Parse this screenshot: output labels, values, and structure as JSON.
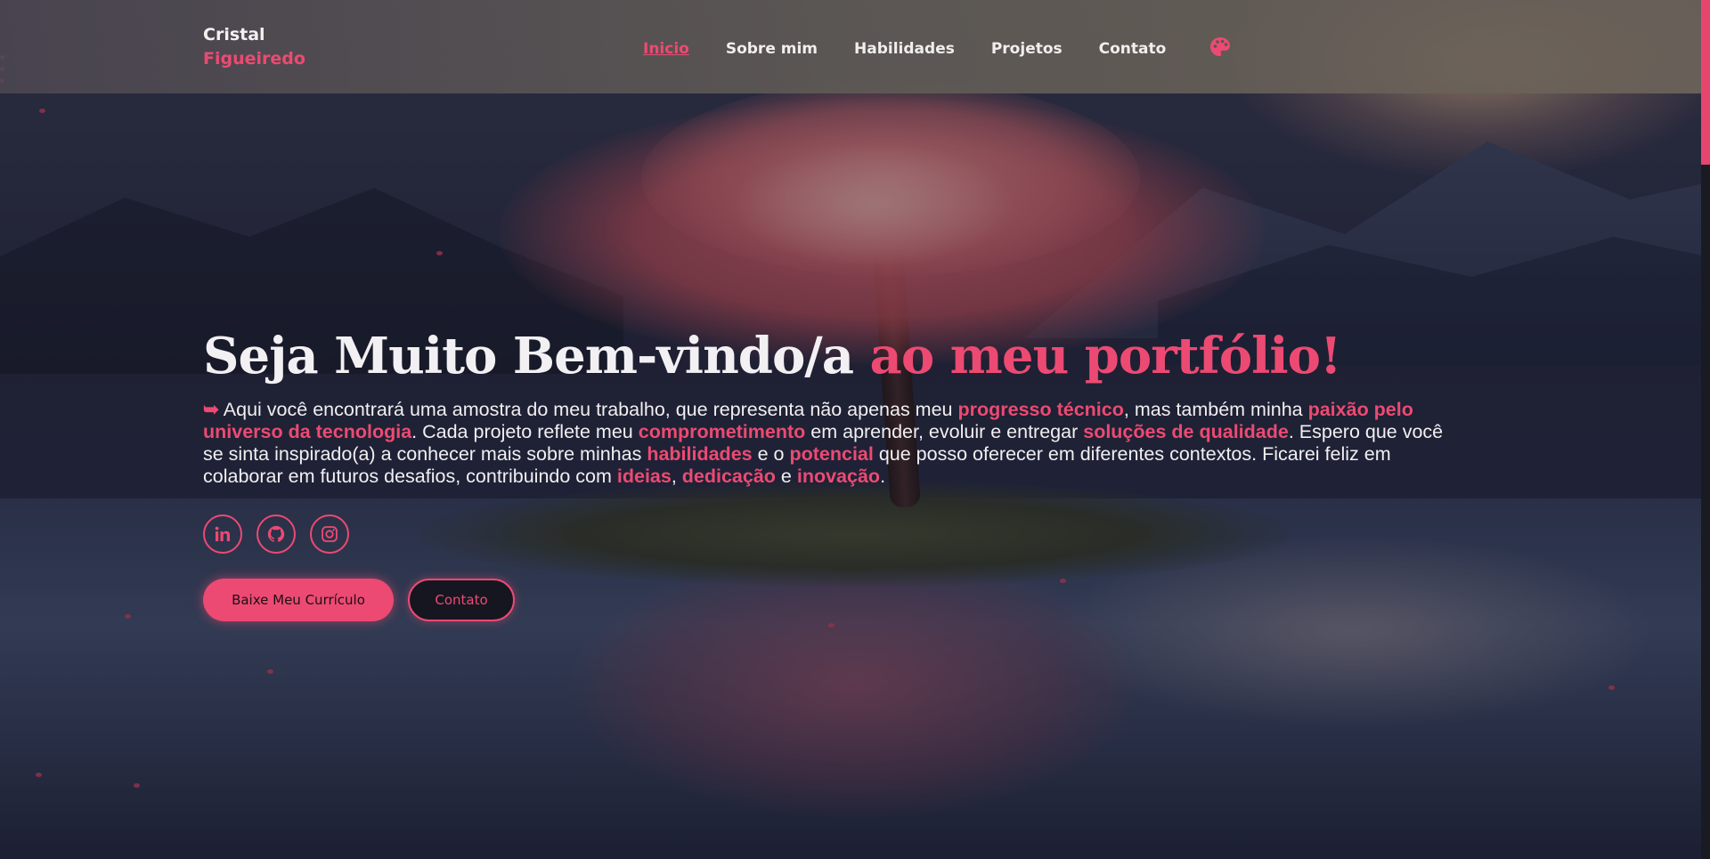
{
  "brand": {
    "first_name": "Cristal",
    "last_name": "Figueiredo"
  },
  "nav": {
    "items": [
      {
        "label": "Inicio",
        "active": true
      },
      {
        "label": "Sobre mim",
        "active": false
      },
      {
        "label": "Habilidades",
        "active": false
      },
      {
        "label": "Projetos",
        "active": false
      },
      {
        "label": "Contato",
        "active": false
      }
    ],
    "theme_icon": "palette-icon"
  },
  "hero": {
    "title_plain": "Seja Muito Bem-vindo/a",
    "title_highlight": "ao meu portfólio!",
    "intro": {
      "arrow": "➥",
      "p1": " Aqui você encontrará uma amostra do meu trabalho, que representa não apenas meu ",
      "h1": "progresso técnico",
      "p2": ", mas também minha ",
      "h2": "paixão pelo universo da tecnologia",
      "p3": ". Cada projeto reflete meu ",
      "h3": "comprometimento",
      "p4": " em aprender, evoluir e entregar ",
      "h4": "soluções de qualidade",
      "p5": ". Espero que você se sinta inspirado(a) a conhecer mais sobre minhas ",
      "h5": "habilidades",
      "p6": " e o ",
      "h6": "potencial",
      "p7": " que posso oferecer em diferentes contextos. Ficarei feliz em colaborar em futuros desafios, contribuindo com ",
      "h7": "ideias",
      "p8": ", ",
      "h8": "dedicação",
      "p9": " e ",
      "h9": "inovação",
      "p10": "."
    }
  },
  "socials": [
    {
      "icon": "linkedin-icon"
    },
    {
      "icon": "github-icon"
    },
    {
      "icon": "instagram-icon"
    }
  ],
  "actions": {
    "cv_label": "Baixe Meu Currículo",
    "contact_label": "Contato"
  },
  "colors": {
    "accent": "#ec4a72",
    "text": "#f1eff1",
    "dark": "#161620"
  }
}
